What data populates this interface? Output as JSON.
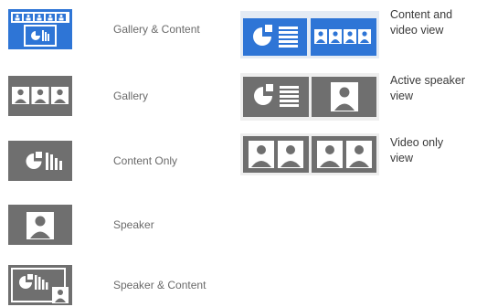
{
  "left_layouts": [
    {
      "label": "Gallery & Content",
      "icon": "gallery-content-icon",
      "selected": true
    },
    {
      "label": "Gallery",
      "icon": "gallery-icon",
      "selected": false
    },
    {
      "label": "Content Only",
      "icon": "content-only-icon",
      "selected": false
    },
    {
      "label": "Speaker",
      "icon": "speaker-icon",
      "selected": false
    },
    {
      "label": "Speaker & Content",
      "icon": "speaker-content-icon",
      "selected": false
    }
  ],
  "right_views": [
    {
      "label": "Content and\nvideo view",
      "icon": "content-video-view-icon",
      "selected": true
    },
    {
      "label": "Active speaker\nview",
      "icon": "active-speaker-view-icon",
      "selected": false
    },
    {
      "label": "Video only\nview",
      "icon": "video-only-view-icon",
      "selected": false
    }
  ],
  "colors": {
    "selected": "#2e75d6",
    "unselected": "#6f6f6f",
    "tile_light": "#e4ebf4",
    "tile_gray": "#eeeeee",
    "label_left": "#6a6a6a",
    "label_right": "#3a3a3a"
  }
}
